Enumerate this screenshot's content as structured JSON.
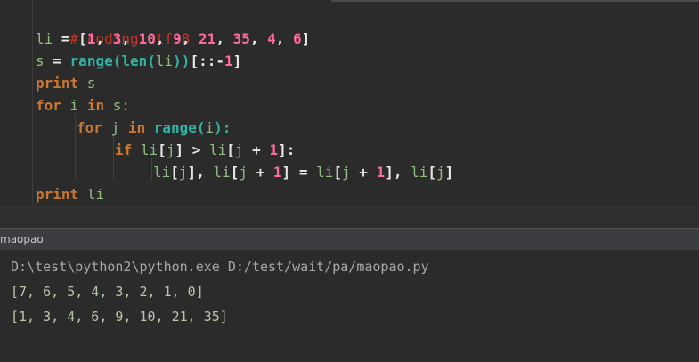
{
  "editor": {
    "comment": "# coding:utf-8",
    "lines": {
      "l2": {
        "a": "li",
        "b": " = [",
        "n1": "1",
        "c1": ", ",
        "n2": "3",
        "c2": ", ",
        "n3": "10",
        "c3": ", ",
        "n4": "9",
        "c4": ", ",
        "n5": "21",
        "c5": ", ",
        "n6": "35",
        "c6": ", ",
        "n7": "4",
        "c7": ", ",
        "n8": "6",
        "end": "]"
      },
      "l3": {
        "a": "s",
        "b": " = ",
        "fn1": "range",
        "p1": "(",
        "fn2": "len",
        "p2": "(",
        "v": "li",
        "p3": "))",
        "s1": "[::-",
        "n": "1",
        "s2": "]"
      },
      "l4": {
        "kw": "print",
        "v": " s"
      },
      "l5": {
        "kw1": "for",
        "v1": " i ",
        "kw2": "in",
        "v2": " s:"
      },
      "l6": {
        "kw1": "for",
        "v1": " j ",
        "kw2": "in",
        "sp": " ",
        "fn": "range",
        "p1": "(",
        "v": "i",
        "p2": "):"
      },
      "l7": {
        "kw": "if",
        "v1": " li",
        "b1": "[",
        "v2": "j",
        "b2": "]",
        "op": " > ",
        "v3": "li",
        "b3": "[",
        "v4": "j",
        "op2": " + ",
        "n": "1",
        "b4": "]:"
      },
      "l8": {
        "v1": "li",
        "b1": "[",
        "v2": "j",
        "b2": "]",
        "c1": ", ",
        "v3": "li",
        "b3": "[",
        "v4": "j",
        "op1": " + ",
        "n1": "1",
        "b4": "]",
        "eq": " = ",
        "v5": "li",
        "b5": "[",
        "v6": "j",
        "op2": " + ",
        "n2": "1",
        "b6": "]",
        "c2": ", ",
        "v7": "li",
        "b7": "[",
        "v8": "j",
        "b8": "]"
      },
      "l9": {
        "kw": "print",
        "v": " li"
      }
    }
  },
  "run_panel": {
    "tab_label": "maopao"
  },
  "console": {
    "command": "D:\\test\\python2\\python.exe D:/test/wait/pa/maopao.py",
    "output_1": "[7, 6, 5, 4, 3, 2, 1, 0]",
    "output_2": "[1, 3, 4, 6, 9, 10, 21, 35]"
  },
  "colors": {
    "background": "#2b2b2b",
    "keyword": "#cc7832",
    "number": "#ff6b9c",
    "builtin": "#2fb5a5",
    "comment": "#c0392b"
  }
}
